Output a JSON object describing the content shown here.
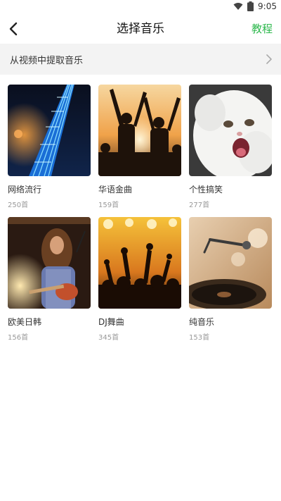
{
  "status": {
    "time": "9:05",
    "icons": [
      "wifi-icon",
      "battery-icon"
    ]
  },
  "header": {
    "back_icon": "chevron-left-icon",
    "title": "选择音乐",
    "tutorial_label": "教程"
  },
  "extract": {
    "label": "从视频中提取音乐",
    "icon": "chevron-right-icon"
  },
  "colors": {
    "accent": "#2db84d",
    "row_bg": "#f3f3f3",
    "count_text": "#999999"
  },
  "categories": [
    {
      "name": "网络流行",
      "count": "250首",
      "image": "guitar-neck-blue-lights"
    },
    {
      "name": "华语金曲",
      "count": "159首",
      "image": "crowd-silhouettes-sunset"
    },
    {
      "name": "个性搞笑",
      "count": "277首",
      "image": "white-persian-cat"
    },
    {
      "name": "欧美日韩",
      "count": "156首",
      "image": "long-haired-guitarist-on-stage"
    },
    {
      "name": "DJ舞曲",
      "count": "345首",
      "image": "concert-crowd-hands-up"
    },
    {
      "name": "纯音乐",
      "count": "153首",
      "image": "vinyl-record-player"
    }
  ]
}
